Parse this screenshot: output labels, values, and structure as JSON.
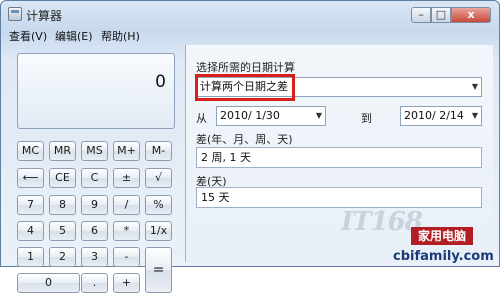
{
  "window": {
    "title": "计算器",
    "controls": {
      "minimize": "–",
      "maximize": "□",
      "close": "x"
    }
  },
  "menu": [
    "查看(V)",
    "编辑(E)",
    "帮助(H)"
  ],
  "calculator": {
    "display": "0",
    "keys": [
      {
        "label": "MC"
      },
      {
        "label": "MR"
      },
      {
        "label": "MS"
      },
      {
        "label": "M+"
      },
      {
        "label": "M-"
      },
      {
        "label": "⟵"
      },
      {
        "label": "CE"
      },
      {
        "label": "C"
      },
      {
        "label": "±"
      },
      {
        "label": "√"
      },
      {
        "label": "7"
      },
      {
        "label": "8"
      },
      {
        "label": "9"
      },
      {
        "label": "/"
      },
      {
        "label": "%"
      },
      {
        "label": "4"
      },
      {
        "label": "5"
      },
      {
        "label": "6"
      },
      {
        "label": "*"
      },
      {
        "label": "1/x"
      },
      {
        "label": "1"
      },
      {
        "label": "2"
      },
      {
        "label": "3"
      },
      {
        "label": "-"
      },
      {
        "label": "="
      },
      {
        "label": "0"
      },
      {
        "label": "."
      },
      {
        "label": "+"
      }
    ]
  },
  "date_panel": {
    "calc_label": "选择所需的日期计算",
    "calc_selected": "计算两个日期之差",
    "from_label": "从",
    "from_date": "2010/ 1/30",
    "to_label": "到",
    "to_date": "2010/ 2/14",
    "diff_label": "差(年、月、周、天)",
    "diff_value": "2 周, 1 天",
    "days_label": "差(天)",
    "days_value": "15 天"
  },
  "branding": {
    "logo_text": "IT168",
    "badge_text": "家用电脑",
    "watermark": "cbifamily.com"
  }
}
